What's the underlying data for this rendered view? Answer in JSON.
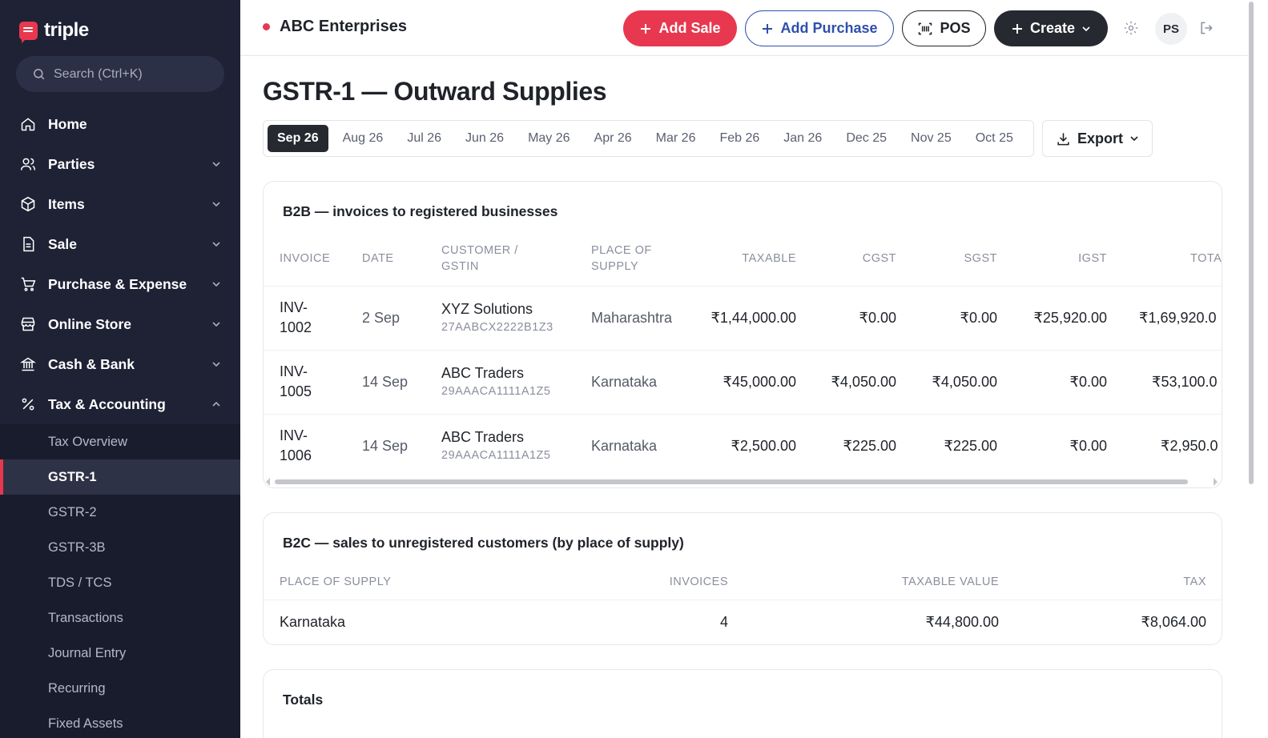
{
  "brand": {
    "name": "triple",
    "accent": "#e8384f",
    "sidebar_bg": "#1f2235"
  },
  "search": {
    "placeholder": "Search (Ctrl+K)"
  },
  "sidebar": {
    "items": [
      {
        "label": "Home",
        "icon": "home-icon",
        "expandable": false
      },
      {
        "label": "Parties",
        "icon": "users-icon",
        "expandable": true
      },
      {
        "label": "Items",
        "icon": "box-icon",
        "expandable": true
      },
      {
        "label": "Sale",
        "icon": "document-icon",
        "expandable": true
      },
      {
        "label": "Purchase & Expense",
        "icon": "cart-icon",
        "expandable": true
      },
      {
        "label": "Online Store",
        "icon": "store-icon",
        "expandable": true
      },
      {
        "label": "Cash & Bank",
        "icon": "bank-icon",
        "expandable": true
      },
      {
        "label": "Tax & Accounting",
        "icon": "percent-icon",
        "expandable": true,
        "expanded": true
      }
    ],
    "sub_items": [
      {
        "label": "Tax Overview"
      },
      {
        "label": "GSTR-1",
        "active": true
      },
      {
        "label": "GSTR-2"
      },
      {
        "label": "GSTR-3B"
      },
      {
        "label": "TDS / TCS"
      },
      {
        "label": "Transactions"
      },
      {
        "label": "Journal Entry"
      },
      {
        "label": "Recurring"
      },
      {
        "label": "Fixed Assets"
      }
    ]
  },
  "header": {
    "company": "ABC Enterprises",
    "add_sale": "Add Sale",
    "add_purchase": "Add Purchase",
    "pos": "POS",
    "create": "Create",
    "avatar_initials": "PS"
  },
  "page": {
    "title": "GSTR-1 — Outward Supplies",
    "months": [
      "Sep 26",
      "Aug 26",
      "Jul 26",
      "Jun 26",
      "May 26",
      "Apr 26",
      "Mar 26",
      "Feb 26",
      "Jan 26",
      "Dec 25",
      "Nov 25",
      "Oct 25"
    ],
    "active_month": "Sep 26",
    "export_label": "Export"
  },
  "b2b": {
    "title": "B2B — invoices to registered businesses",
    "columns": {
      "invoice": "INVOICE",
      "date": "DATE",
      "customer_1": "CUSTOMER /",
      "customer_2": "GSTIN",
      "place_1": "PLACE OF",
      "place_2": "SUPPLY",
      "taxable": "TAXABLE",
      "cgst": "CGST",
      "sgst": "SGST",
      "igst": "IGST",
      "total": "TOTA"
    },
    "rows": [
      {
        "inv1": "INV-",
        "inv2": "1002",
        "date": "2 Sep",
        "customer": "XYZ Solutions",
        "gstin": "27AABCX2222B1Z3",
        "place": "Maharashtra",
        "taxable": "₹1,44,000.00",
        "cgst": "₹0.00",
        "sgst": "₹0.00",
        "igst": "₹25,920.00",
        "total": "₹1,69,920.0"
      },
      {
        "inv1": "INV-",
        "inv2": "1005",
        "date": "14 Sep",
        "customer": "ABC Traders",
        "gstin": "29AAACA1111A1Z5",
        "place": "Karnataka",
        "taxable": "₹45,000.00",
        "cgst": "₹4,050.00",
        "sgst": "₹4,050.00",
        "igst": "₹0.00",
        "total": "₹53,100.0"
      },
      {
        "inv1": "INV-",
        "inv2": "1006",
        "date": "14 Sep",
        "customer": "ABC Traders",
        "gstin": "29AAACA1111A1Z5",
        "place": "Karnataka",
        "taxable": "₹2,500.00",
        "cgst": "₹225.00",
        "sgst": "₹225.00",
        "igst": "₹0.00",
        "total": "₹2,950.0"
      }
    ]
  },
  "b2c": {
    "title": "B2C — sales to unregistered customers (by place of supply)",
    "columns": {
      "place": "PLACE OF SUPPLY",
      "invoices": "INVOICES",
      "taxable_value": "TAXABLE VALUE",
      "tax": "TAX"
    },
    "rows": [
      {
        "place": "Karnataka",
        "invoices": "4",
        "taxable_value": "₹44,800.00",
        "tax": "₹8,064.00"
      }
    ]
  },
  "totals": {
    "title": "Totals"
  }
}
